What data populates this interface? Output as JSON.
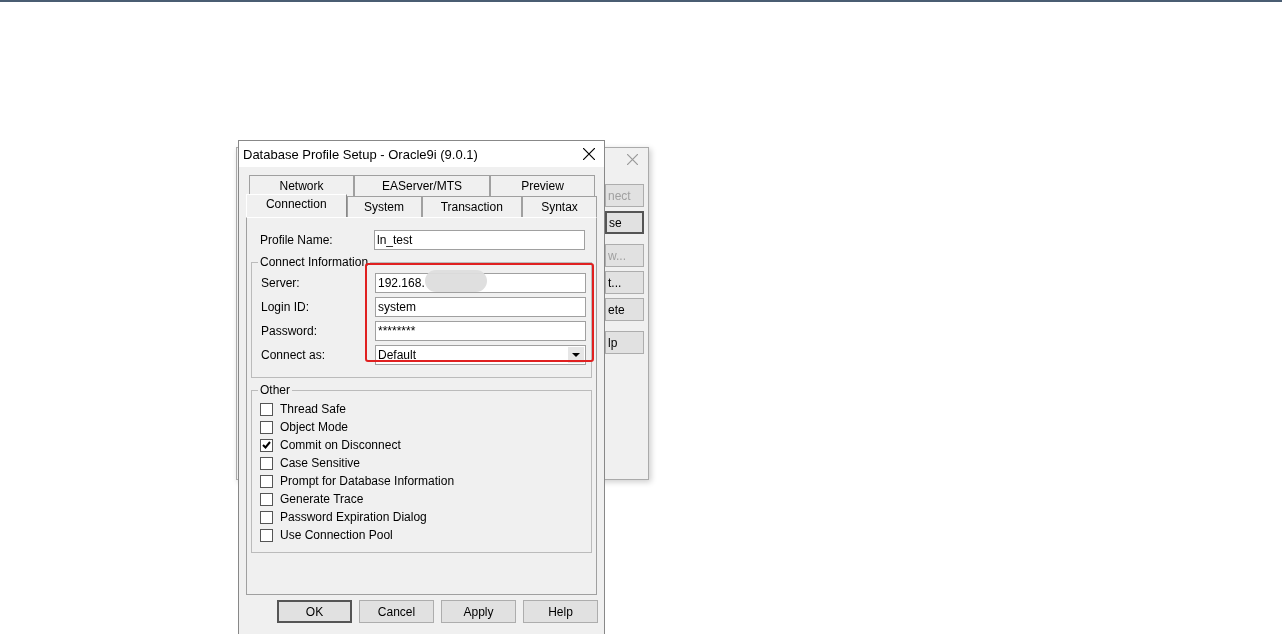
{
  "background_window": {
    "buttons": [
      {
        "label": "nect",
        "disabled": true,
        "default": false
      },
      {
        "label": "se",
        "disabled": false,
        "default": true
      },
      {
        "label": "w...",
        "disabled": true,
        "default": false
      },
      {
        "label": "t...",
        "disabled": false,
        "default": false
      },
      {
        "label": "ete",
        "disabled": false,
        "default": false
      },
      {
        "label": "lp",
        "disabled": false,
        "default": false
      }
    ]
  },
  "dialog": {
    "title": "Database Profile Setup - Oracle9i (9.0.1)",
    "tab_rows": [
      [
        {
          "label": "Network",
          "selected": false
        },
        {
          "label": "EAServer/MTS",
          "selected": false
        },
        {
          "label": "Preview",
          "selected": false
        }
      ],
      [
        {
          "label": "Connection",
          "selected": true
        },
        {
          "label": "System",
          "selected": false
        },
        {
          "label": "Transaction",
          "selected": false
        },
        {
          "label": "Syntax",
          "selected": false
        }
      ]
    ],
    "profile_name": {
      "label": "Profile Name:",
      "value": "ln_test"
    },
    "connect_information": {
      "title": "Connect Information",
      "fields": [
        {
          "kind": "text",
          "label": "Server:",
          "value": "192.168.",
          "redacted": true
        },
        {
          "kind": "text",
          "label": "Login ID:",
          "value": "system",
          "redacted": false
        },
        {
          "kind": "text",
          "label": "Password:",
          "value": "********",
          "redacted": false
        },
        {
          "kind": "dropdown",
          "label": "Connect as:",
          "value": "Default",
          "redacted": false
        }
      ]
    },
    "other": {
      "title": "Other",
      "options": [
        {
          "label": "Thread Safe",
          "checked": false
        },
        {
          "label": "Object Mode",
          "checked": false
        },
        {
          "label": "Commit on Disconnect",
          "checked": true
        },
        {
          "label": "Case Sensitive",
          "checked": false
        },
        {
          "label": "Prompt for Database Information",
          "checked": false
        },
        {
          "label": "Generate Trace",
          "checked": false
        },
        {
          "label": "Password Expiration Dialog",
          "checked": false
        },
        {
          "label": "Use Connection Pool",
          "checked": false
        }
      ]
    },
    "buttons": [
      "OK",
      "Cancel",
      "Apply",
      "Help"
    ]
  }
}
